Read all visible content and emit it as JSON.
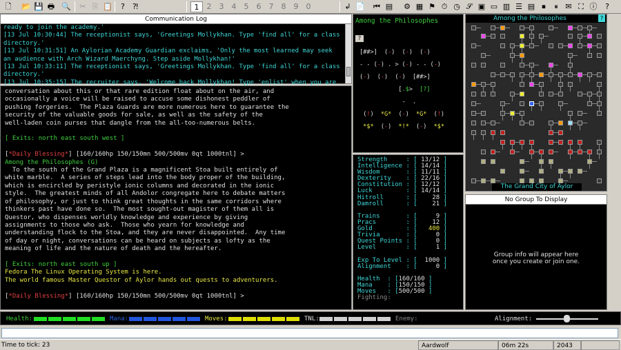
{
  "toolbar": {
    "tab_numbers": [
      "1",
      "2",
      "3",
      "4",
      "5",
      "6",
      "7",
      "8",
      "9",
      "0"
    ],
    "active_tab": "1"
  },
  "comm_log": {
    "title": "Communication Log",
    "lines": [
      [
        {
          "t": "ready to join the academy.'",
          "c": "cyan"
        }
      ],
      [
        {
          "t": "[13 Jul 10:30:44] The receptionist says, 'Greetings Mollykhan. Type 'find all' for a class",
          "c": "cyan"
        }
      ],
      [
        {
          "t": "directory.'",
          "c": "cyan"
        }
      ],
      [
        {
          "t": "[13 Jul 10:31:51] An Aylorian Academy Guardian exclaims, 'Only the most learned may seek",
          "c": "cyan"
        }
      ],
      [
        {
          "t": "an audience with Arch Wizard Maerchyng. Step aside Mollykhan!'",
          "c": "cyan"
        }
      ],
      [
        {
          "t": "[13 Jul 10:33:11] The receptionist says, 'Greetings Mollykhan. Type 'find all' for a class",
          "c": "cyan"
        }
      ],
      [
        {
          "t": "directory.'",
          "c": "cyan"
        }
      ],
      [
        {
          "t": "[13 Jul 10:35:15] The recruiter says, 'Welcome back Mollykhan! Type 'enlist' when you are",
          "c": "cyan"
        }
      ],
      [
        {
          "t": "ready to join the academy.'",
          "c": "cyan"
        }
      ]
    ]
  },
  "main_output": {
    "lines": [
      [
        {
          "t": "conversation about this or that rare edition float about on the air, and",
          "c": "white"
        }
      ],
      [
        {
          "t": "occasionally a voice will be raised to accuse some dishonest peddler of",
          "c": "white"
        }
      ],
      [
        {
          "t": "pushing forgeries.  The Plaza Guards are more numerous here to guarantee the",
          "c": "white"
        }
      ],
      [
        {
          "t": "security of the valuable goods for sale, as well as the safety of the",
          "c": "white"
        }
      ],
      [
        {
          "t": "well-laden coin purses that dangle from the all-too-numerous belts.",
          "c": "white"
        }
      ],
      [
        {
          "t": " ",
          "c": "white"
        }
      ],
      [
        {
          "t": "[ Exits: north east south west ]",
          "c": "green"
        }
      ],
      [
        {
          "t": " ",
          "c": "white"
        }
      ],
      [
        {
          "t": "[",
          "c": "white"
        },
        {
          "t": "*Daily Blessing*",
          "c": "red"
        },
        {
          "t": "] [160/160hp 150/150mn 500/500mv 0qt 1000tnl] >",
          "c": "white"
        }
      ],
      [
        {
          "t": "Among the Philosophes (G)",
          "c": "green"
        }
      ],
      [
        {
          "t": "  To the south of the Grand Plaza is a magnificent Stoa built entirely of",
          "c": "white"
        }
      ],
      [
        {
          "t": "white marble.  A series of steps lead into the body proper of the building,",
          "c": "white"
        }
      ],
      [
        {
          "t": "which is encircled by peristyle ionic columns and decorated in the ionic",
          "c": "white"
        }
      ],
      [
        {
          "t": "style.  The greatest minds of all Andolor congregate here to debate matters",
          "c": "white"
        }
      ],
      [
        {
          "t": "of philosophy, or just to think great thoughts in the same corridors where",
          "c": "white"
        }
      ],
      [
        {
          "t": "thinkers past have done so.  The most sought-out magister of them all is",
          "c": "white"
        }
      ],
      [
        {
          "t": "Questor, who dispenses worldly knowledge and experience by giving",
          "c": "white"
        }
      ],
      [
        {
          "t": "assignments to those who ask.  Those who yearn for knowledge and",
          "c": "white"
        }
      ],
      [
        {
          "t": "understanding flock to the Stoa, and they are never disappointed.  Any time",
          "c": "white"
        }
      ],
      [
        {
          "t": "of day or night, conversations can be heard on subjects as lofty as the",
          "c": "white"
        }
      ],
      [
        {
          "t": "meaning of life and the nature of death and the hereafter.",
          "c": "white"
        }
      ],
      [
        {
          "t": " ",
          "c": "white"
        }
      ],
      [
        {
          "t": "[ Exits: north east south up ]",
          "c": "green"
        }
      ],
      [
        {
          "t": "Fedora The Linux Operating System is here.",
          "c": "yellow"
        }
      ],
      [
        {
          "t": "The world famous Master Questor of Aylor hands out quests to adventurers.",
          "c": "yellow"
        }
      ],
      [
        {
          "t": " ",
          "c": "white"
        }
      ],
      [
        {
          "t": "[",
          "c": "white"
        },
        {
          "t": "*Daily Blessing*",
          "c": "red"
        },
        {
          "t": "] [160/160hp 150/150mn 500/500mv 0qt 1000tnl] >",
          "c": "white"
        }
      ]
    ]
  },
  "room_map": {
    "title": "Among the Philosophes",
    "button": "?",
    "lines": [
      [
        {
          "t": "   ",
          "c": "white"
        }
      ],
      [
        {
          "t": " [",
          "c": "white"
        },
        {
          "t": "#",
          "c": "white"
        },
        {
          "t": "#>",
          "c": "white"
        },
        {
          "t": "]",
          "c": "white"
        },
        {
          "t": "  (",
          "c": "white"
        },
        {
          "t": "-",
          "c": "red"
        },
        {
          "t": ")  (",
          "c": "white"
        },
        {
          "t": "-",
          "c": "red"
        },
        {
          "t": ")  (",
          "c": "white"
        },
        {
          "t": "-",
          "c": "red"
        },
        {
          "t": ")",
          "c": "white"
        }
      ],
      [
        {
          "t": " ",
          "c": "white"
        }
      ],
      [
        {
          "t": " - - (",
          "c": "white"
        },
        {
          "t": "-",
          "c": "red"
        },
        {
          "t": ") . > (",
          "c": "white"
        },
        {
          "t": "-",
          "c": "red"
        },
        {
          "t": ") - - (",
          "c": "white"
        },
        {
          "t": "-",
          "c": "red"
        },
        {
          "t": ")",
          "c": "white"
        }
      ],
      [
        {
          "t": " ",
          "c": "white"
        }
      ],
      [
        {
          "t": " (",
          "c": "white"
        },
        {
          "t": "-",
          "c": "red"
        },
        {
          "t": ")  (",
          "c": "white"
        },
        {
          "t": "-",
          "c": "red"
        },
        {
          "t": ")  (",
          "c": "white"
        },
        {
          "t": "-",
          "c": "red"
        },
        {
          "t": ")  [",
          "c": "white"
        },
        {
          "t": "##>",
          "c": "white"
        },
        {
          "t": "]",
          "c": "white"
        }
      ],
      [
        {
          "t": " ",
          "c": "white"
        }
      ],
      [
        {
          "t": "            [",
          "c": "white"
        },
        {
          "t": ".$",
          "c": "green"
        },
        {
          "t": ">  ",
          "c": "white"
        },
        {
          "t": "[?]",
          "c": "green"
        }
      ],
      [
        {
          "t": " ",
          "c": "white"
        }
      ],
      [
        {
          "t": "             -  .",
          "c": "white"
        }
      ],
      [
        {
          "t": " ",
          "c": "white"
        }
      ],
      [
        {
          "t": "  (",
          "c": "white"
        },
        {
          "t": "!",
          "c": "red"
        },
        {
          "t": ")  ",
          "c": "white"
        },
        {
          "t": "*G*",
          "c": "yellow"
        },
        {
          "t": "  (",
          "c": "white"
        },
        {
          "t": "-",
          "c": "red"
        },
        {
          "t": ")  ",
          "c": "white"
        },
        {
          "t": "*G*",
          "c": "yellow"
        },
        {
          "t": "  (",
          "c": "white"
        },
        {
          "t": "!",
          "c": "red"
        },
        {
          "t": ")",
          "c": "white"
        }
      ],
      [
        {
          "t": " ",
          "c": "white"
        }
      ],
      [
        {
          "t": "  ",
          "c": "white"
        },
        {
          "t": "*$*",
          "c": "yellow"
        },
        {
          "t": "  (",
          "c": "white"
        },
        {
          "t": "-",
          "c": "red"
        },
        {
          "t": ")  ",
          "c": "white"
        },
        {
          "t": "*!*",
          "c": "yellow"
        },
        {
          "t": "  (",
          "c": "white"
        },
        {
          "t": "-",
          "c": "red"
        },
        {
          "t": ")  ",
          "c": "white"
        },
        {
          "t": "*$*",
          "c": "yellow"
        }
      ]
    ]
  },
  "stats": [
    {
      "label": "Strength",
      "value": "13/12"
    },
    {
      "label": "Intelligence",
      "value": "14/14"
    },
    {
      "label": "Wisdom",
      "value": "11/11"
    },
    {
      "label": "Dexterity",
      "value": "22/16"
    },
    {
      "label": "Constitution",
      "value": "12/12"
    },
    {
      "label": "Luck",
      "value": "14/14"
    },
    {
      "label": "Hitroll",
      "value": "28"
    },
    {
      "label": "Damroll",
      "value": "21"
    },
    {
      "label": "",
      "value": ""
    },
    {
      "label": "Trains",
      "value": "9"
    },
    {
      "label": "Pracs",
      "value": "12"
    },
    {
      "label": "Gold",
      "value": "400"
    },
    {
      "label": "Trivia",
      "value": "0"
    },
    {
      "label": "Quest Points",
      "value": "0"
    },
    {
      "label": "Level",
      "value": "1"
    },
    {
      "label": "",
      "value": ""
    },
    {
      "label": "Exp To Level",
      "value": "1000"
    },
    {
      "label": "Alignment",
      "value": "0"
    },
    {
      "label": "",
      "value": ""
    },
    {
      "label": "Health",
      "value": "160/160"
    },
    {
      "label": "Mana",
      "value": "150/150"
    },
    {
      "label": "Moves",
      "value": "500/500"
    },
    {
      "label": "Fighting",
      "value": ""
    }
  ],
  "area_map": {
    "title": "Among the Philosophes",
    "footer": "The Grand City of Aylor",
    "close": "?"
  },
  "group": {
    "title": "No Group To Display",
    "message_line1": "Group info will appear here",
    "message_line2": "once you create or join one."
  },
  "bars": {
    "health_label": "Health:",
    "mana_label": "Mana:",
    "moves_label": "Moves:",
    "tnl_label": "TNL:",
    "enemy_label": "Enemy:",
    "alignment_label": "Alignment:",
    "health_fill": 1.0,
    "mana_fill": 1.0,
    "moves_fill": 1.0,
    "tnl_fill": 1.0,
    "colors": {
      "health": "#22dd22",
      "mana": "#2255dd",
      "moves": "#dddd00",
      "tnl": "#d0d0d0"
    }
  },
  "input": {
    "value": ""
  },
  "status_bar": {
    "tick": "Time to tick: 23",
    "world": "Aardwolf",
    "elapsed": "06m 22s",
    "count": "2043"
  }
}
